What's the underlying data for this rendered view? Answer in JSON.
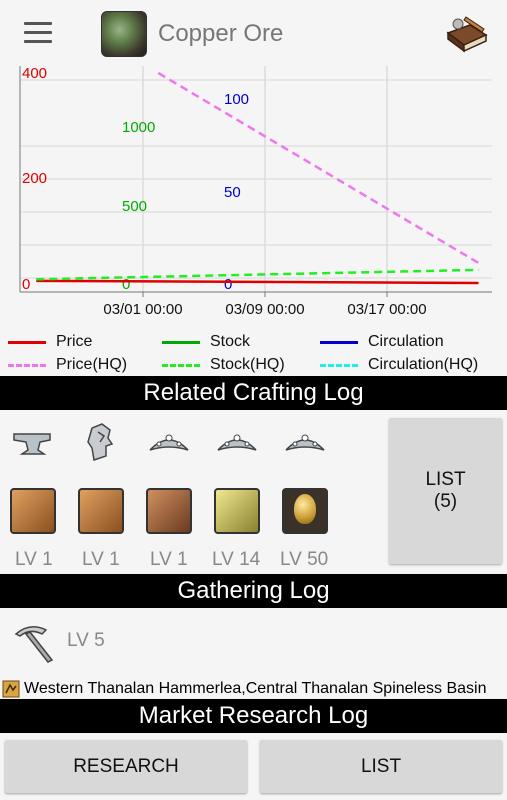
{
  "header": {
    "title": "Copper Ore",
    "menu_icon": "hamburger-menu-icon",
    "item_icon": "copper-ore-icon",
    "book_icon": "book-quill-icon"
  },
  "chart_data": {
    "type": "line",
    "x_ticks": [
      "03/01 00:00",
      "03/09 00:00",
      "03/17 00:00"
    ],
    "price_axis": {
      "ticks": [
        "0",
        "200",
        "400"
      ],
      "color": "#e00000"
    },
    "stock_axis": {
      "ticks": [
        "0",
        "500",
        "1000"
      ],
      "color": "#00aa00"
    },
    "circulation_axis": {
      "ticks": [
        "0",
        "50",
        "100"
      ],
      "color": "#0000cc"
    },
    "series": [
      {
        "name": "Price",
        "color": "#e00000",
        "style": "solid",
        "x": [
          "02/22",
          "03/23"
        ],
        "y": [
          6,
          2
        ]
      },
      {
        "name": "Stock",
        "color": "#00aa00",
        "style": "solid",
        "x": [],
        "y": []
      },
      {
        "name": "Circulation",
        "color": "#0000cc",
        "style": "solid",
        "x": [],
        "y": []
      },
      {
        "name": "Price(HQ)",
        "color": "#ee77ee",
        "style": "dashed",
        "x": [
          "03/02",
          "03/23"
        ],
        "y": [
          400,
          40
        ]
      },
      {
        "name": "Stock(HQ)",
        "color": "#22ee22",
        "style": "dashed",
        "x": [
          "02/22",
          "03/23"
        ],
        "y": [
          30,
          90
        ]
      },
      {
        "name": "Circulation(HQ)",
        "color": "#22eeee",
        "style": "dashed",
        "x": [],
        "y": []
      }
    ]
  },
  "sections": {
    "crafting": "Related Crafting Log",
    "gathering": "Gathering Log",
    "market": "Market Research Log"
  },
  "crafting": {
    "classes": [
      "anvil-icon",
      "goldsmith-head-icon",
      "tiara-icon",
      "tiara-icon",
      "tiara-icon"
    ],
    "items": [
      {
        "icon": "copper-ingot-icon",
        "level": "LV 1"
      },
      {
        "icon": "copper-ingot-icon",
        "level": "LV 1"
      },
      {
        "icon": "copper-nugget-icon",
        "level": "LV 1"
      },
      {
        "icon": "brass-ingot-icon",
        "level": "LV 14"
      },
      {
        "icon": "golden-egg-icon",
        "level": "LV 50"
      }
    ],
    "list_label": "LIST",
    "list_count": "(5)"
  },
  "gathering": {
    "tool_icon": "pickaxe-icon",
    "level": "LV 5",
    "location_icon": "map-icon",
    "locations": "Western Thanalan Hammerlea,Central Thanalan Spineless Basin"
  },
  "buttons": {
    "research": "RESEARCH",
    "list": "LIST"
  }
}
